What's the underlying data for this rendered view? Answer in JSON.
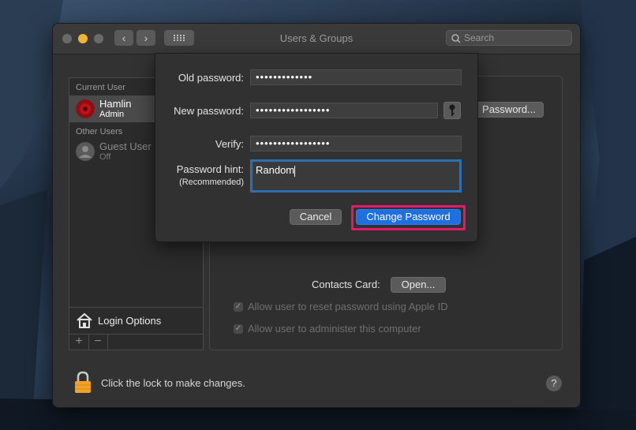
{
  "window": {
    "title": "Users & Groups",
    "search_placeholder": "Search"
  },
  "sidebar": {
    "current_user_header": "Current User",
    "current_user": {
      "name": "Hamlin",
      "role": "Admin"
    },
    "other_users_header": "Other Users",
    "guest_user": {
      "name": "Guest User",
      "status": "Off"
    },
    "login_options_label": "Login Options",
    "add_label": "+",
    "remove_label": "−"
  },
  "main": {
    "password_button_label": "Password...",
    "contacts_card_label": "Contacts Card:",
    "open_button_label": "Open...",
    "allow_reset_label": "Allow user to reset password using Apple ID",
    "allow_admin_label": "Allow user to administer this computer"
  },
  "sheet": {
    "old_password_label": "Old password:",
    "old_password_value": "•••••••••••••",
    "new_password_label": "New password:",
    "new_password_value": "•••••••••••••••••",
    "verify_label": "Verify:",
    "verify_value": "•••••••••••••••••",
    "hint_label": "Password hint:",
    "hint_sublabel": "(Recommended)",
    "hint_value": "Random",
    "cancel_label": "Cancel",
    "change_label": "Change Password"
  },
  "footer": {
    "lock_text": "Click the lock to make changes.",
    "help_label": "?"
  },
  "colors": {
    "accent": "#1f6fe0",
    "highlight": "#e5196a",
    "focus_ring": "#2e6fb0"
  },
  "icons": [
    "chevron-left-icon",
    "chevron-right-icon",
    "grid-icon",
    "search-icon",
    "avatar-rose-icon",
    "guest-user-icon",
    "house-icon",
    "key-icon",
    "lock-icon",
    "help-icon",
    "checkmark-icon"
  ]
}
